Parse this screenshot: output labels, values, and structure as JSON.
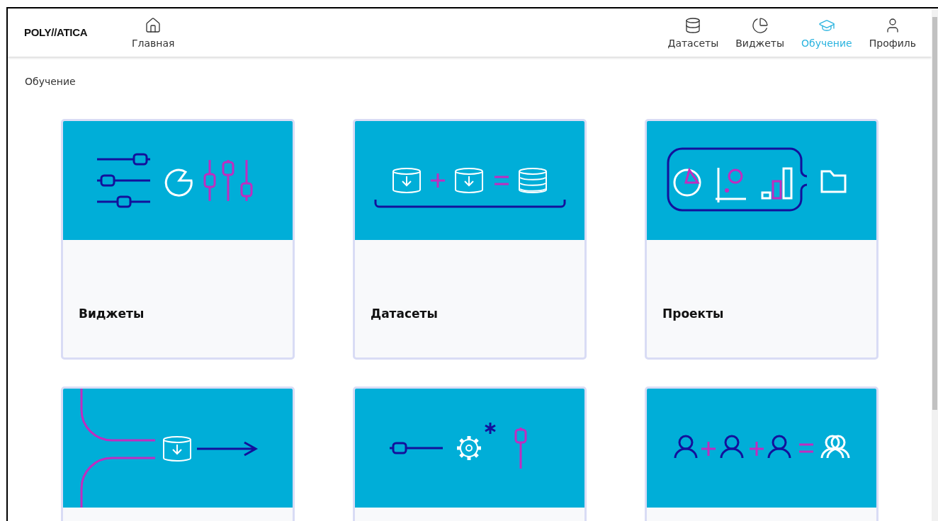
{
  "header": {
    "logo": "POLY//ATICA",
    "nav_left": [
      {
        "label": "Главная",
        "kind": "home",
        "selected": false
      }
    ],
    "nav_right": [
      {
        "label": "Датасеты",
        "kind": "database",
        "selected": false
      },
      {
        "label": "Виджеты",
        "kind": "pie",
        "selected": false
      },
      {
        "label": "Обучение",
        "kind": "cap",
        "selected": true
      },
      {
        "label": "Профиль",
        "kind": "user",
        "selected": false
      }
    ]
  },
  "page_title": "Обучение",
  "cards": [
    {
      "kind": "widgets",
      "title": "Виджеты"
    },
    {
      "kind": "datasets",
      "title": "Датасеты"
    },
    {
      "kind": "projects",
      "title": "Проекты"
    },
    {
      "kind": "flow"
    },
    {
      "kind": "settings"
    },
    {
      "kind": "users"
    }
  ]
}
